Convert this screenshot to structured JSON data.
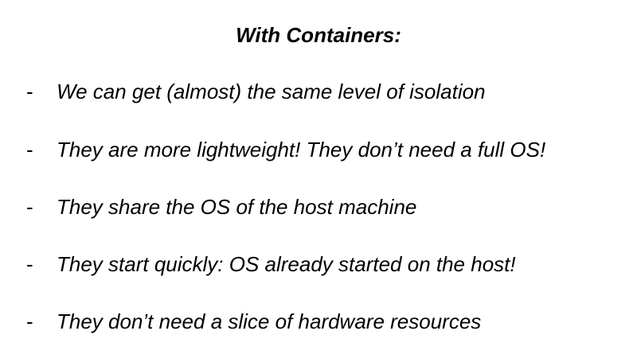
{
  "title": "With Containers:",
  "bullet_marker": "-",
  "bullets": [
    "We can get (almost) the same level of isolation",
    "They are more lightweight! They don’t need a full OS!",
    "They share the OS of the host machine",
    "They start quickly: OS already started on the host!",
    "They don’t need a slice of hardware resources"
  ]
}
